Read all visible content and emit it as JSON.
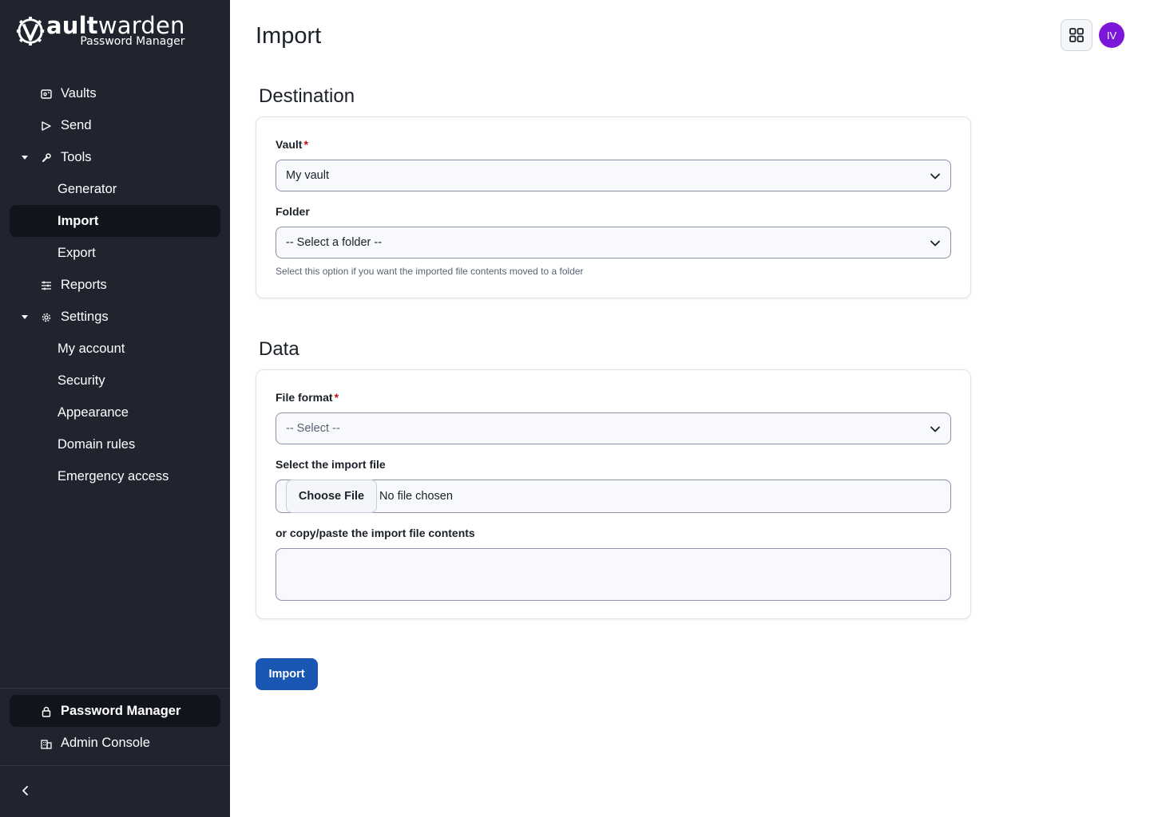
{
  "brand": {
    "logo_word_bold": "ault",
    "logo_word_rest": "warden",
    "logo_sub": "Password Manager"
  },
  "sidebar": {
    "items": [
      {
        "label": "Vaults",
        "icon": "vault-icon"
      },
      {
        "label": "Send",
        "icon": "send-icon"
      },
      {
        "label": "Tools",
        "icon": "wrench-icon",
        "expanded": true
      },
      {
        "label": "Generator"
      },
      {
        "label": "Import",
        "active": true
      },
      {
        "label": "Export"
      },
      {
        "label": "Reports",
        "icon": "sliders-icon"
      },
      {
        "label": "Settings",
        "icon": "gear-icon",
        "expanded": true
      },
      {
        "label": "My account"
      },
      {
        "label": "Security"
      },
      {
        "label": "Appearance"
      },
      {
        "label": "Domain rules"
      },
      {
        "label": "Emergency access"
      }
    ],
    "bottom": [
      {
        "label": "Password Manager",
        "icon": "lock-icon",
        "active": true
      },
      {
        "label": "Admin Console",
        "icon": "building-icon"
      }
    ]
  },
  "header": {
    "title": "Import",
    "avatar_initials": "IV",
    "avatar_color": "#7a17d9"
  },
  "destination": {
    "title": "Destination",
    "vault_label": "Vault",
    "vault_value": "My vault",
    "folder_label": "Folder",
    "folder_value": "-- Select a folder --",
    "folder_hint": "Select this option if you want the imported file contents moved to a folder"
  },
  "data": {
    "title": "Data",
    "format_label": "File format",
    "format_value": "-- Select --",
    "file_label": "Select the import file",
    "file_button": "Choose File",
    "file_status": "No file chosen",
    "paste_label": "or copy/paste the import file contents",
    "paste_value": ""
  },
  "actions": {
    "import_label": "Import",
    "primary_color": "#1a56b3"
  }
}
